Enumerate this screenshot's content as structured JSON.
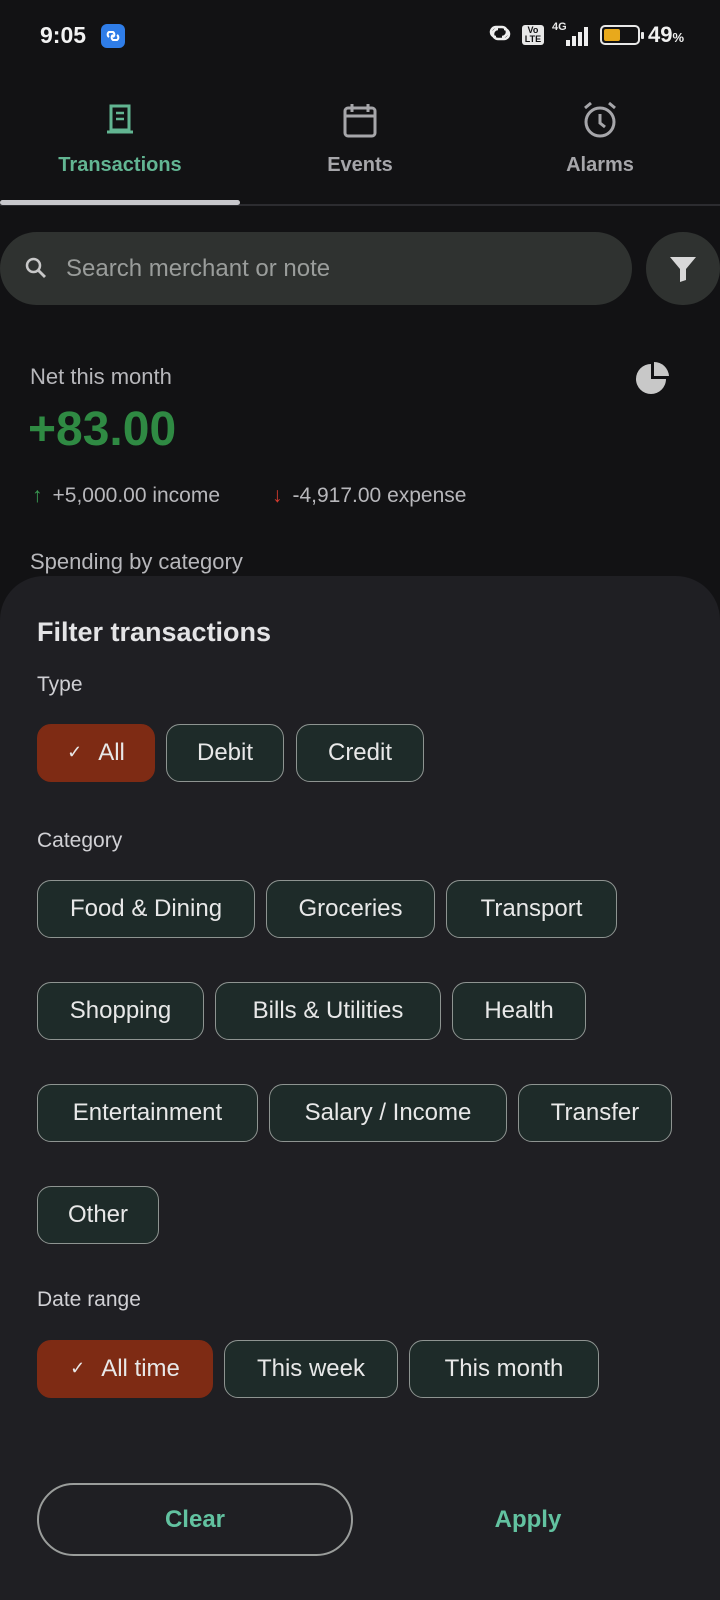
{
  "status_bar": {
    "time": "9:05",
    "battery_percent": "49",
    "battery_unit": "%",
    "network": "4G",
    "volte": "Vo LTE"
  },
  "tabs": [
    {
      "label": "Transactions",
      "icon": "receipt-icon",
      "active": true
    },
    {
      "label": "Events",
      "icon": "calendar-icon",
      "active": false
    },
    {
      "label": "Alarms",
      "icon": "alarm-icon",
      "active": false
    }
  ],
  "search": {
    "placeholder": "Search merchant or note"
  },
  "summary": {
    "net_label": "Net this month",
    "net_value": "+83.00",
    "income": "+5,000.00 income",
    "expense": "-4,917.00 expense",
    "spending_label": "Spending by category"
  },
  "filter_sheet": {
    "title": "Filter transactions",
    "type_label": "Type",
    "type_options": [
      {
        "label": "All",
        "selected": true
      },
      {
        "label": "Debit",
        "selected": false
      },
      {
        "label": "Credit",
        "selected": false
      }
    ],
    "category_label": "Category",
    "category_options": [
      "Food & Dining",
      "Groceries",
      "Transport",
      "Shopping",
      "Bills & Utilities",
      "Health",
      "Entertainment",
      "Salary / Income",
      "Transfer",
      "Other"
    ],
    "date_label": "Date range",
    "date_options": [
      {
        "label": "All time",
        "selected": true
      },
      {
        "label": "This week",
        "selected": false
      },
      {
        "label": "This month",
        "selected": false
      }
    ],
    "clear_label": "Clear",
    "apply_label": "Apply"
  },
  "colors": {
    "accent": "#62b592",
    "selected_chip": "#7e2b14",
    "positive": "#2f8a43",
    "negative": "#d23a2e"
  }
}
